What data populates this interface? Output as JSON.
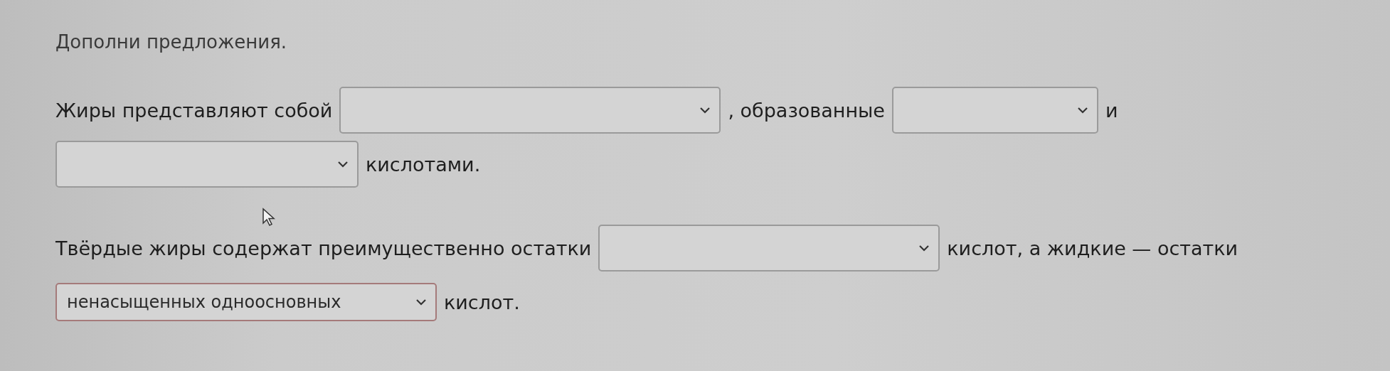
{
  "instruction": "Дополни предложения.",
  "sentences": [
    {
      "lines": [
        [
          {
            "kind": "text",
            "text": "Жиры представляют собой"
          },
          {
            "kind": "select"
          },
          {
            "kind": "text",
            "text": ", образованные"
          },
          {
            "kind": "select"
          },
          {
            "kind": "text",
            "text": "и"
          }
        ],
        [
          {
            "kind": "select"
          },
          {
            "kind": "text",
            "text": "кислотами."
          }
        ]
      ]
    },
    {
      "lines": [
        [
          {
            "kind": "text",
            "text": "Твёрдые жиры содержат преимущественно остатки"
          },
          {
            "kind": "select"
          },
          {
            "kind": "text",
            "text": "кислот, а жидкие — остатки"
          }
        ],
        [
          {
            "kind": "select",
            "value": "ненасыщенных одноосновных"
          },
          {
            "kind": "text",
            "text": "кислот."
          }
        ]
      ]
    }
  ]
}
